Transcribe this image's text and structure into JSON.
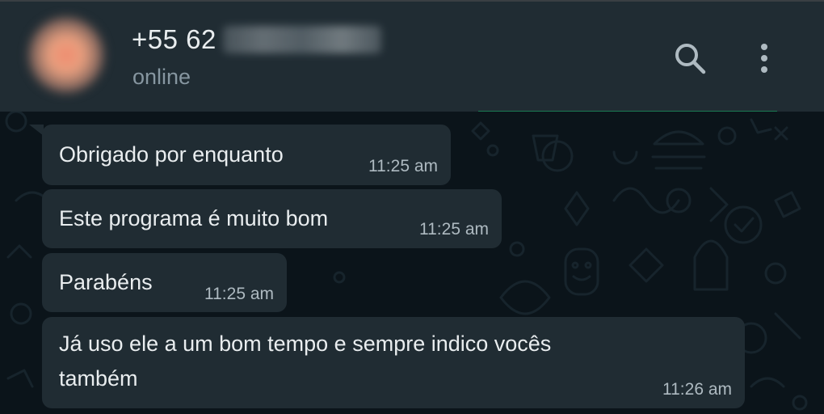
{
  "header": {
    "phone_prefix": "+55 62",
    "status": "online",
    "icons": {
      "search": "search-icon",
      "menu": "kebab-menu-icon"
    }
  },
  "messages": [
    {
      "text": "Obrigado por enquanto",
      "time": "11:25 am"
    },
    {
      "text": "Este programa é muito bom",
      "time": "11:25 am"
    },
    {
      "text": "Parabéns",
      "time": "11:25 am"
    },
    {
      "text_line1": "Já uso ele a um bom tempo e sempre indico vocês",
      "text_line2": "também",
      "time": "11:26 am"
    }
  ],
  "colors": {
    "header_bg": "#202c33",
    "chat_bg": "#0b141a",
    "bubble_bg": "#202c33",
    "primary_text": "#e9edef",
    "secondary_text": "#8696a0",
    "accent": "#1b7a52"
  }
}
